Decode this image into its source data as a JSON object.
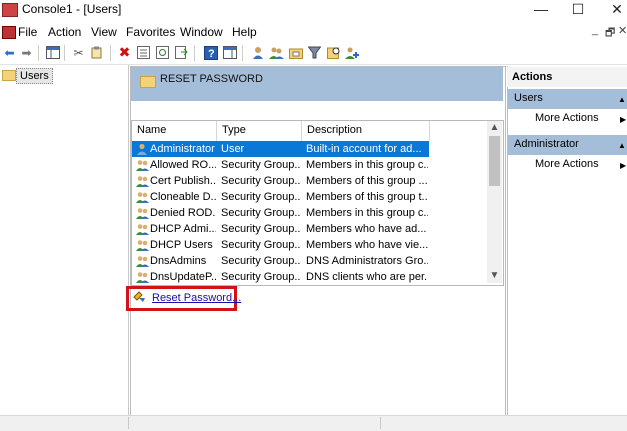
{
  "window": {
    "title": "Console1 - [Users]",
    "controls": {
      "minimize": "—",
      "maximize": "☐",
      "close": "✕"
    }
  },
  "menu": {
    "items": [
      "File",
      "Action",
      "View",
      "Favorites",
      "Window",
      "Help"
    ],
    "mdi_controls": {
      "minimize": "_",
      "restore": "🗗",
      "close": "✕"
    }
  },
  "toolbar": {
    "icons": [
      "back-arrow-icon",
      "forward-arrow-icon",
      "show-hide-tree-icon",
      "cut-icon",
      "copy-icon",
      "delete-icon",
      "properties-icon",
      "refresh-icon",
      "export-list-icon",
      "help-icon",
      "show-hide-action-pane-icon",
      "new-user-icon",
      "new-group-icon",
      "new-ou-icon",
      "filter-icon",
      "find-icon",
      "add-to-group-icon"
    ]
  },
  "tree": {
    "items": [
      {
        "label": "Users",
        "selected": true
      }
    ]
  },
  "center": {
    "header_title": "RESET PASSWORD",
    "list": {
      "columns": [
        "Name",
        "Type",
        "Description"
      ],
      "rows": [
        {
          "name": "Administrator",
          "type": "User",
          "description": "Built-in account for ad...",
          "icon": "user-icon",
          "selected": true
        },
        {
          "name": "Allowed RO...",
          "type": "Security Group...",
          "description": "Members in this group c...",
          "icon": "group-icon",
          "selected": false
        },
        {
          "name": "Cert Publish...",
          "type": "Security Group...",
          "description": "Members of this group ...",
          "icon": "group-icon",
          "selected": false
        },
        {
          "name": "Cloneable D...",
          "type": "Security Group...",
          "description": "Members of this group t...",
          "icon": "group-icon",
          "selected": false
        },
        {
          "name": "Denied ROD...",
          "type": "Security Group...",
          "description": "Members in this group c...",
          "icon": "group-icon",
          "selected": false
        },
        {
          "name": "DHCP Admi...",
          "type": "Security Group...",
          "description": "Members who have ad...",
          "icon": "group-icon",
          "selected": false
        },
        {
          "name": "DHCP Users",
          "type": "Security Group...",
          "description": "Members who have vie...",
          "icon": "group-icon",
          "selected": false
        },
        {
          "name": "DnsAdmins",
          "type": "Security Group...",
          "description": "DNS Administrators Gro...",
          "icon": "group-icon",
          "selected": false
        },
        {
          "name": "DnsUpdateP...",
          "type": "Security Group...",
          "description": "DNS clients who are per...",
          "icon": "group-icon",
          "selected": false
        }
      ]
    },
    "task_link": {
      "label": "Reset Password...",
      "icon": "reset-password-icon"
    }
  },
  "actions": {
    "title": "Actions",
    "sections": [
      {
        "heading": "Users",
        "items": [
          {
            "label": "More Actions"
          }
        ]
      },
      {
        "heading": "Administrator",
        "items": [
          {
            "label": "More Actions"
          }
        ]
      }
    ]
  },
  "colors": {
    "header_band": "#a4bdd9",
    "selection": "#0a78d7",
    "highlight_box": "#d1121b",
    "link": "#1a0dab"
  }
}
